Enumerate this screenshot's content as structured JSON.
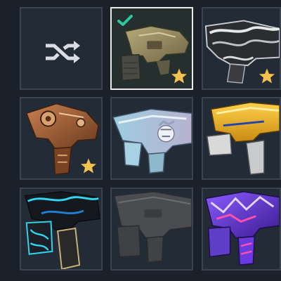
{
  "skins": [
    {
      "name": "random-skin",
      "type": "shuffle",
      "favorite": false,
      "equipped": false
    },
    {
      "name": "tan-smg",
      "type": "skin",
      "favorite": true,
      "equipped": true
    },
    {
      "name": "black-white-smg",
      "type": "skin",
      "favorite": true,
      "equipped": false
    },
    {
      "name": "copper-steampunk-smg",
      "type": "skin",
      "favorite": true,
      "equipped": false
    },
    {
      "name": "anime-pastel-smg",
      "type": "skin",
      "favorite": false,
      "equipped": false
    },
    {
      "name": "gold-blue-smg",
      "type": "skin",
      "favorite": false,
      "equipped": false
    },
    {
      "name": "black-cyan-smg",
      "type": "skin",
      "favorite": false,
      "equipped": false
    },
    {
      "name": "default-grey-smg",
      "type": "skin",
      "favorite": false,
      "equipped": false
    },
    {
      "name": "purple-graffiti-smg",
      "type": "skin",
      "favorite": false,
      "equipped": false
    }
  ],
  "colors": {
    "background": "#1a212b",
    "tile_border": "#3a4350",
    "selected_border": "#e8ecef",
    "check": "#2fc6a0",
    "star": "#f2c14e"
  },
  "icons": {
    "shuffle": "shuffle-icon",
    "equipped": "check-icon",
    "favorite": "star-icon"
  }
}
